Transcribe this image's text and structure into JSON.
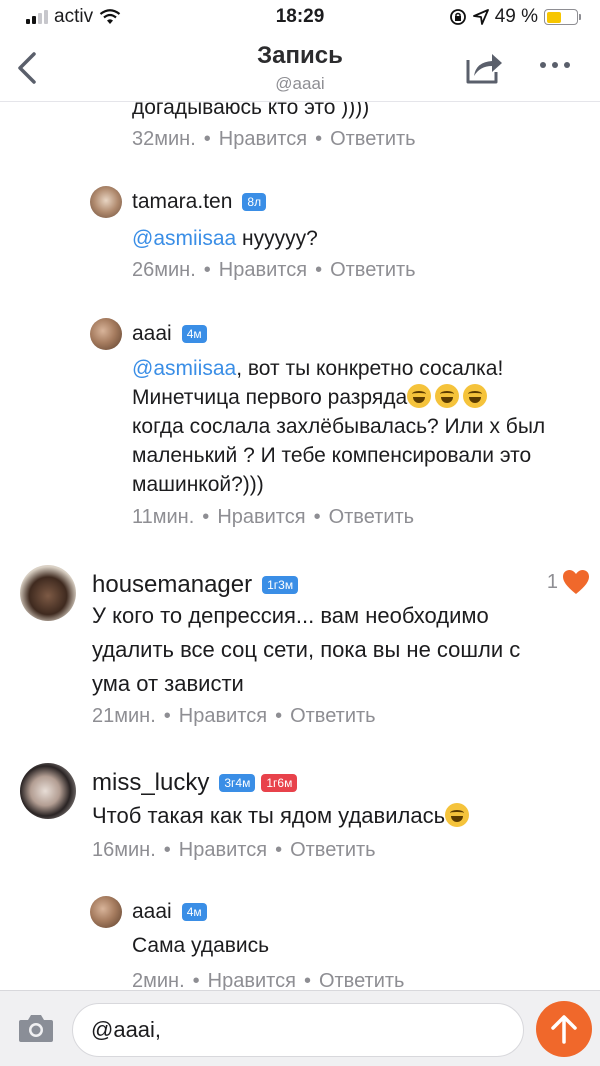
{
  "status_bar": {
    "carrier": "activ",
    "time": "18:29",
    "battery_percent": "49 %",
    "battery_level": 0.49
  },
  "header": {
    "title": "Запись",
    "subtitle": "@aaai"
  },
  "comments": [
    {
      "id": "c0",
      "text_tail": "догадываюсь кто это ))))",
      "time": "32мин.",
      "like_label": "Нравится",
      "reply_label": "Ответить"
    },
    {
      "id": "c1",
      "username": "tamara.ten",
      "badges": [
        "8л"
      ],
      "mention": "@asmiisaa",
      "text": " нууууу?",
      "time": "26мин.",
      "like_label": "Нравится",
      "reply_label": "Ответить"
    },
    {
      "id": "c2",
      "username": "aaai",
      "badges": [
        "4м"
      ],
      "mention": "@asmiisaa",
      "text_line1": ", вот ты конкретно сосалка!",
      "text_line2": "Минетчица первого разряда",
      "text_line3": "когда сослала захлёбывалась? Или х был",
      "text_line4": "маленький ? И тебе компенсировали это",
      "text_line5": "машинкой?)))",
      "emojis": [
        "face-with-tears-of-joy",
        "face-with-tears-of-joy",
        "face-with-tears-of-joy"
      ],
      "time": "11мин.",
      "like_label": "Нравится",
      "reply_label": "Ответить"
    },
    {
      "id": "c3",
      "username": "housemanager",
      "badges": [
        "1г3м"
      ],
      "text_line1": "У кого то депрессия... вам необходимо",
      "text_line2": "удалить все соц сети, пока вы не сошли с",
      "text_line3": "ума от зависти",
      "likes_count": "1",
      "time": "21мин.",
      "like_label": "Нравится",
      "reply_label": "Ответить"
    },
    {
      "id": "c4",
      "username": "miss_lucky",
      "badges": [
        "3г4м",
        "1г6м"
      ],
      "text": "Чтоб такая как ты ядом удавилась",
      "emoji": "grinning-face",
      "time": "16мин.",
      "like_label": "Нравится",
      "reply_label": "Ответить"
    },
    {
      "id": "c5",
      "username": "aaai",
      "badges": [
        "4м"
      ],
      "text": "Сама удавись",
      "time": "2мин.",
      "like_label": "Нравится",
      "reply_label": "Ответить"
    }
  ],
  "composer": {
    "value": "@aaai,"
  },
  "colors": {
    "accent": "#3a8ee6",
    "send_button": "#f0682b",
    "heart": "#f0682b",
    "badge_red": "#e8424b",
    "muted_text": "#8e8e93"
  },
  "icons": [
    "back-chevron-icon",
    "share-icon",
    "more-icon",
    "camera-icon",
    "send-arrow-icon",
    "heart-icon",
    "wifi-icon",
    "location-icon",
    "lock-rotation-icon",
    "battery-icon"
  ]
}
